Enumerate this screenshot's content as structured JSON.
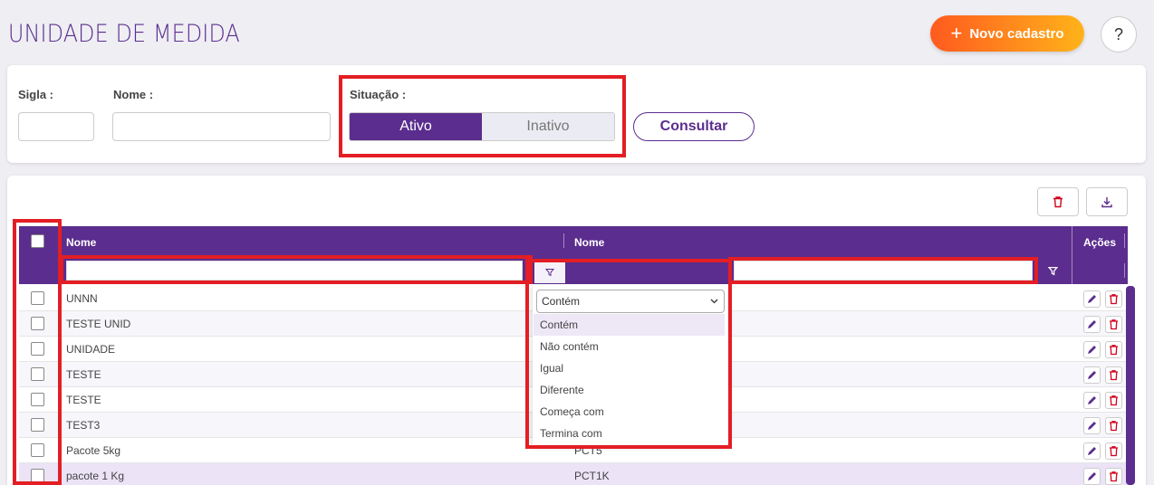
{
  "header": {
    "title": "UNIDADE DE MEDIDA",
    "new_label": "Novo cadastro",
    "help_label": "?"
  },
  "filters": {
    "sigla_label": "Sigla :",
    "nome_label": "Nome :",
    "situacao_label": "Situação :",
    "ativo_label": "Ativo",
    "inativo_label": "Inativo",
    "selected": "Ativo",
    "consult_label": "Consultar"
  },
  "grid": {
    "columns": [
      "Nome",
      "Nome",
      "Ações"
    ],
    "rows": [
      {
        "nome": "UNNN",
        "sigla": ""
      },
      {
        "nome": "TESTE UNID",
        "sigla": ""
      },
      {
        "nome": "UNIDADE",
        "sigla": ""
      },
      {
        "nome": "TESTE",
        "sigla": ""
      },
      {
        "nome": "TESTE",
        "sigla": ""
      },
      {
        "nome": "TEST3",
        "sigla": ""
      },
      {
        "nome": "Pacote 5kg",
        "sigla": "PCT5"
      },
      {
        "nome": "pacote 1 Kg",
        "sigla": "PCT1K"
      }
    ]
  },
  "dropdown": {
    "selected": "Contém",
    "options": [
      "Contém",
      "Não contém",
      "Igual",
      "Diferente",
      "Começa com",
      "Termina com"
    ]
  },
  "colors": {
    "accent": "#5b2d8e",
    "highlight": "#e31e24",
    "delete": "#d0021b"
  }
}
